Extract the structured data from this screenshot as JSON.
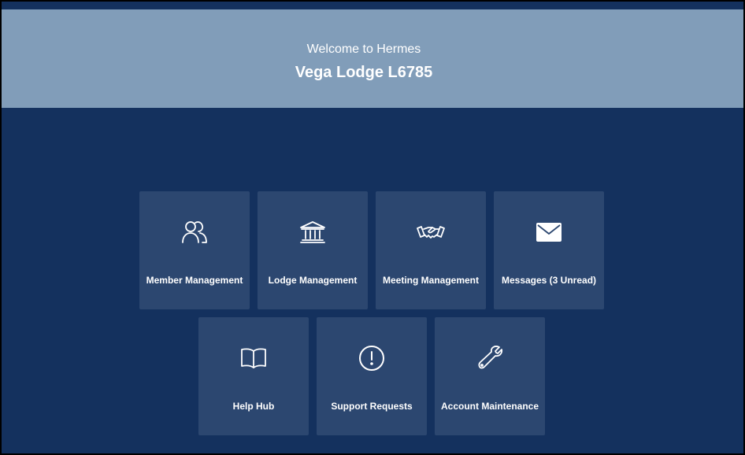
{
  "header": {
    "welcome": "Welcome to Hermes",
    "lodge_name": "Vega Lodge L6785"
  },
  "tiles": [
    {
      "label": "Member Management",
      "icon": "members-icon"
    },
    {
      "label": "Lodge Management",
      "icon": "lodge-building-icon"
    },
    {
      "label": "Meeting Management",
      "icon": "handshake-icon"
    },
    {
      "label": "Messages (3 Unread)",
      "icon": "envelope-icon"
    },
    {
      "label": "Help Hub",
      "icon": "book-icon"
    },
    {
      "label": "Support Requests",
      "icon": "exclamation-circle-icon"
    },
    {
      "label": "Account Maintenance",
      "icon": "wrench-icon"
    }
  ],
  "colors": {
    "background": "#14315e",
    "banner": "#819db9",
    "tile": "#2c4770",
    "text": "#ffffff"
  }
}
